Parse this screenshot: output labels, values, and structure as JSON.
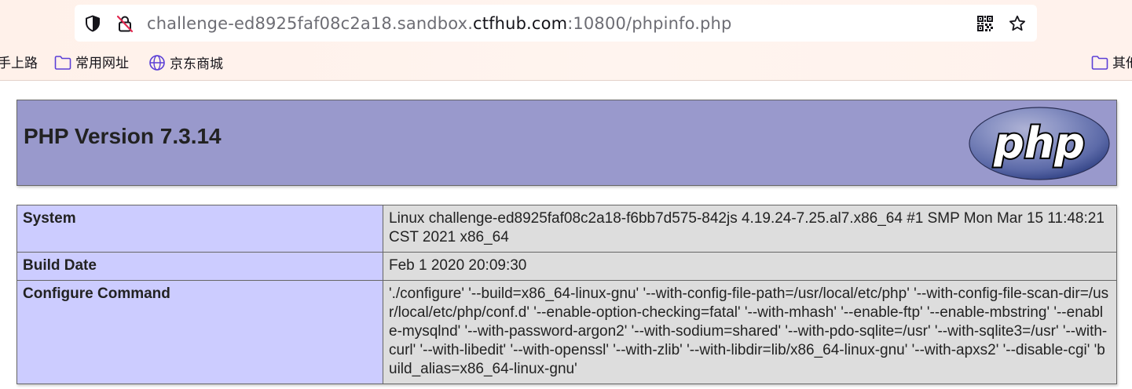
{
  "browser": {
    "url": {
      "prefix": "challenge-ed8925faf08c2a18.sandbox.",
      "domain": "ctfhub.com",
      "suffix": ":10800/phpinfo.php"
    },
    "icons": {
      "tracking_protection": "shield-icon",
      "insecure_connection": "lock-slash-icon",
      "qr_code": "qr-code-icon",
      "bookmark": "star-icon"
    },
    "bookmarks": [
      {
        "label": "手上路",
        "icon": "none"
      },
      {
        "label": "常用网址",
        "icon": "folder-icon"
      },
      {
        "label": "京东商城",
        "icon": "globe-icon"
      }
    ],
    "other_bookmarks": {
      "label": "其他",
      "icon": "folder-icon"
    }
  },
  "page": {
    "header": {
      "title": "PHP Version 7.3.14",
      "logo_text": "php"
    },
    "rows": [
      {
        "key": "System",
        "value": "Linux challenge-ed8925faf08c2a18-f6bb7d575-842js 4.19.24-7.25.al7.x86_64 #1 SMP Mon Mar 15 11:48:21 CST 2021 x86_64"
      },
      {
        "key": "Build Date",
        "value": "Feb 1 2020 20:09:30"
      },
      {
        "key": "Configure Command",
        "value": "'./configure' '--build=x86_64-linux-gnu' '--with-config-file-path=/usr/local/etc/php' '--with-config-file-scan-dir=/usr/local/etc/php/conf.d' '--enable-option-checking=fatal' '--with-mhash' '--enable-ftp' '--enable-mbstring' '--enable-mysqlnd' '--with-password-argon2' '--with-sodium=shared' '--with-pdo-sqlite=/usr' '--with-sqlite3=/usr' '--with-curl' '--with-libedit' '--with-openssl' '--with-zlib' '--with-libdir=lib/x86_64-linux-gnu' '--with-apxs2' '--disable-cgi' 'build_alias=x86_64-linux-gnu'"
      }
    ]
  },
  "colors": {
    "header_bg": "#9999cc",
    "key_cell_bg": "#ccccff",
    "value_cell_bg": "#dddddd",
    "border": "#666666",
    "logo_bg": "#6181b6"
  }
}
